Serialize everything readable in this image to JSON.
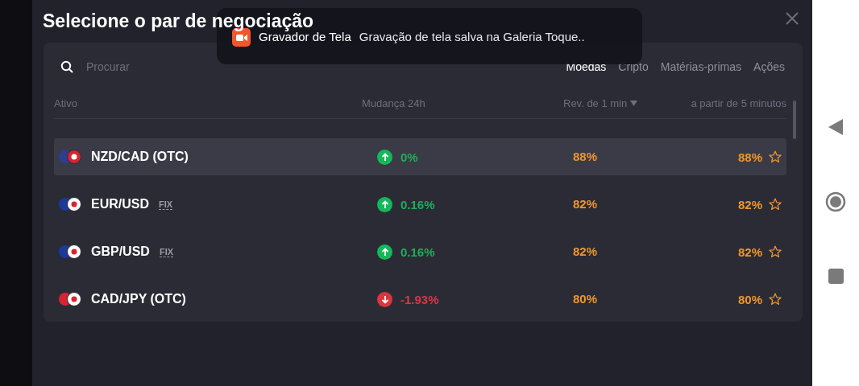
{
  "modal": {
    "title": "Selecione o par de negociação"
  },
  "toast": {
    "app": "Gravador de Tela",
    "message": "Gravação de tela salva na Galeria Toque.."
  },
  "search": {
    "placeholder": "Procurar"
  },
  "tabs": [
    {
      "label": "Moedas",
      "selected": true
    },
    {
      "label": "Cripto",
      "selected": false
    },
    {
      "label": "Matérias-primas",
      "selected": false
    },
    {
      "label": "Ações",
      "selected": false
    }
  ],
  "table": {
    "columns": [
      "Ativo",
      "Mudança 24h",
      "Rev. de 1 min",
      "a partir de 5 minutos"
    ],
    "rows": [
      {
        "name": "NZD/CAD (OTC)",
        "change": "0%",
        "kind": "up",
        "payout_1min": "88%",
        "payout_5min": "88%",
        "selected": true,
        "favorite": false
      },
      {
        "name": "EUR/USD",
        "badge": "FIX",
        "change": "0.16%",
        "kind": "up",
        "payout_1min": "82%",
        "payout_5min": "82%",
        "selected": false,
        "favorite": false
      },
      {
        "name": "GBP/USD",
        "badge": "FIX",
        "change": "0.16%",
        "kind": "up",
        "payout_1min": "82%",
        "payout_5min": "82%",
        "selected": false,
        "favorite": false
      },
      {
        "name": "CAD/JPY (OTC)",
        "change": "-1.93%",
        "kind": "down",
        "payout_1min": "80%",
        "payout_5min": "80%",
        "selected": false,
        "favorite": false
      }
    ]
  }
}
